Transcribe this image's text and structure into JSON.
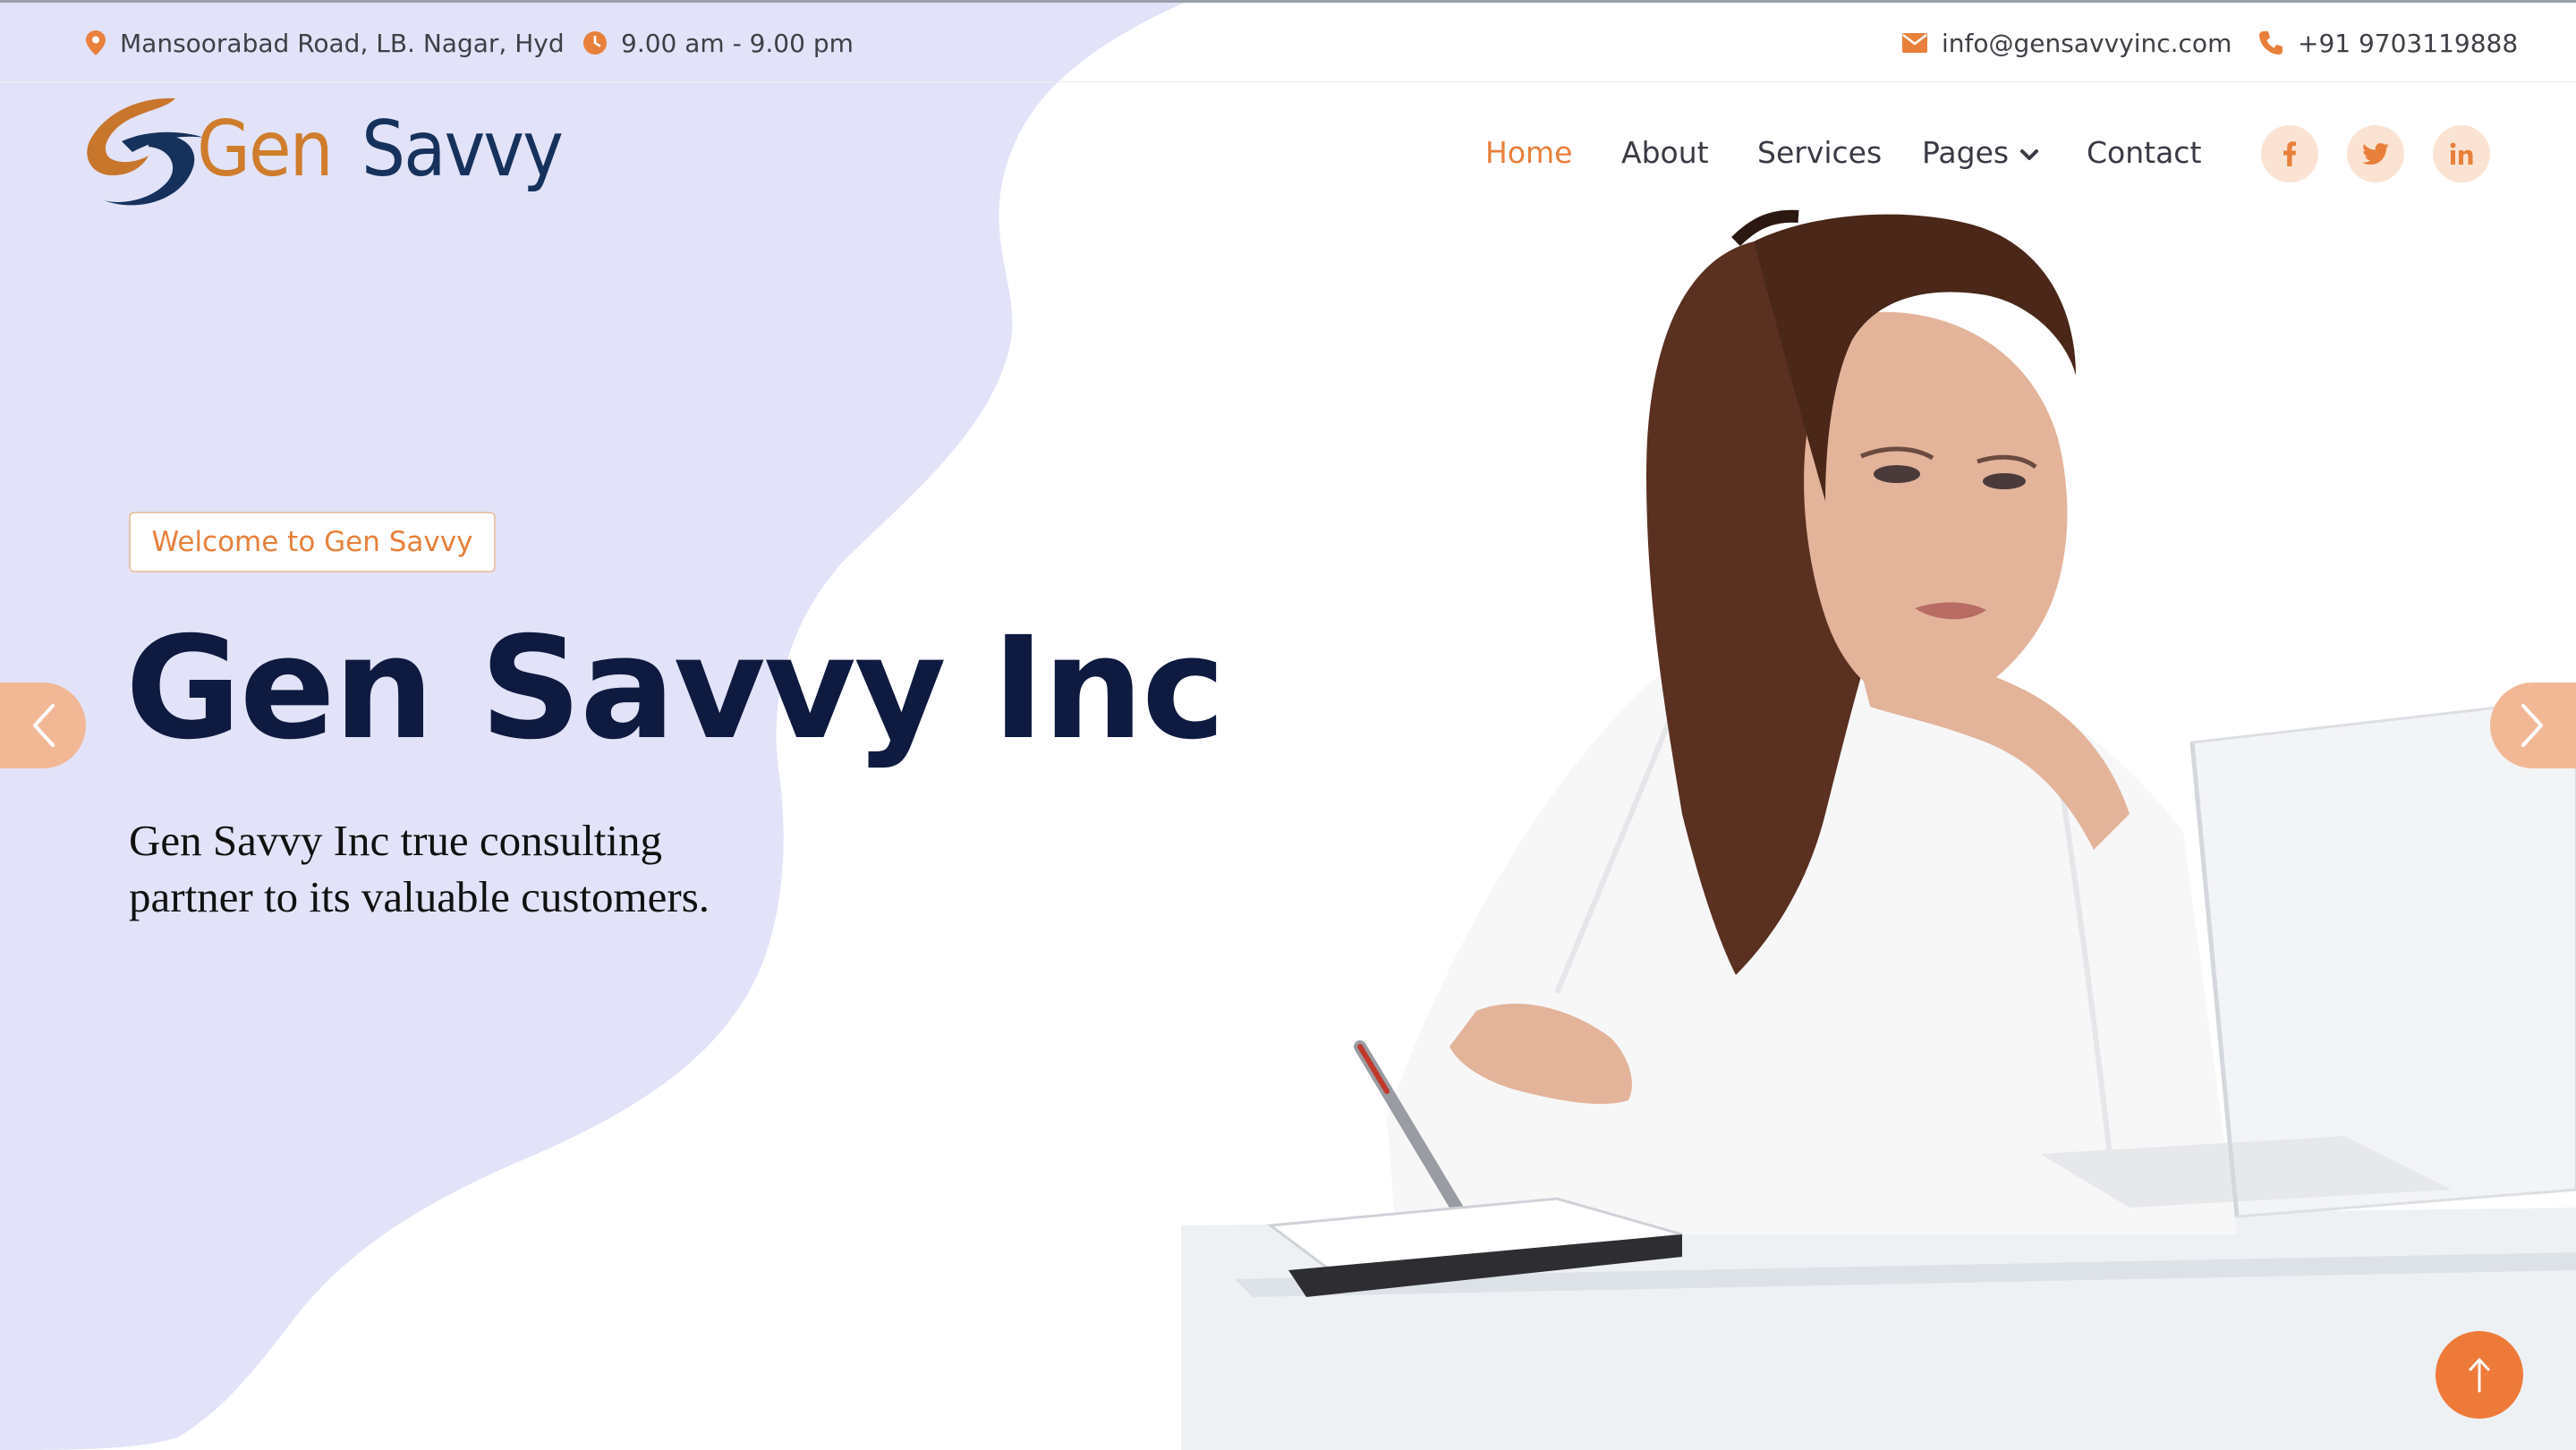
{
  "topbar": {
    "address": "Mansoorabad Road, LB. Nagar, Hyd",
    "hours": "9.00 am - 9.00 pm",
    "email": "info@gensavvyinc.com",
    "phone": "+91 9703119888"
  },
  "brand": {
    "name": "Gen Savvy",
    "accent": "#e8803b",
    "navy": "#16325c"
  },
  "nav": {
    "items": [
      {
        "label": "Home",
        "active": true
      },
      {
        "label": "About",
        "active": false
      },
      {
        "label": "Services",
        "active": false
      },
      {
        "label": "Pages",
        "active": false,
        "dropdown": true
      },
      {
        "label": "Contact",
        "active": false
      }
    ],
    "social": [
      "facebook-icon",
      "twitter-icon",
      "linkedin-icon"
    ]
  },
  "hero": {
    "badge": "Welcome to Gen Savvy",
    "title": "Gen Savvy Inc",
    "subtitle_line1": "Gen Savvy Inc true consulting",
    "subtitle_line2": "partner to its valuable customers."
  },
  "colors": {
    "accent": "#e8803b",
    "lavender": "#e2e3f8",
    "title": "#0e1a3f",
    "arrow_bg": "#f2b896",
    "social_bg": "#fbe3d3",
    "to_top": "#ee7a3a"
  }
}
